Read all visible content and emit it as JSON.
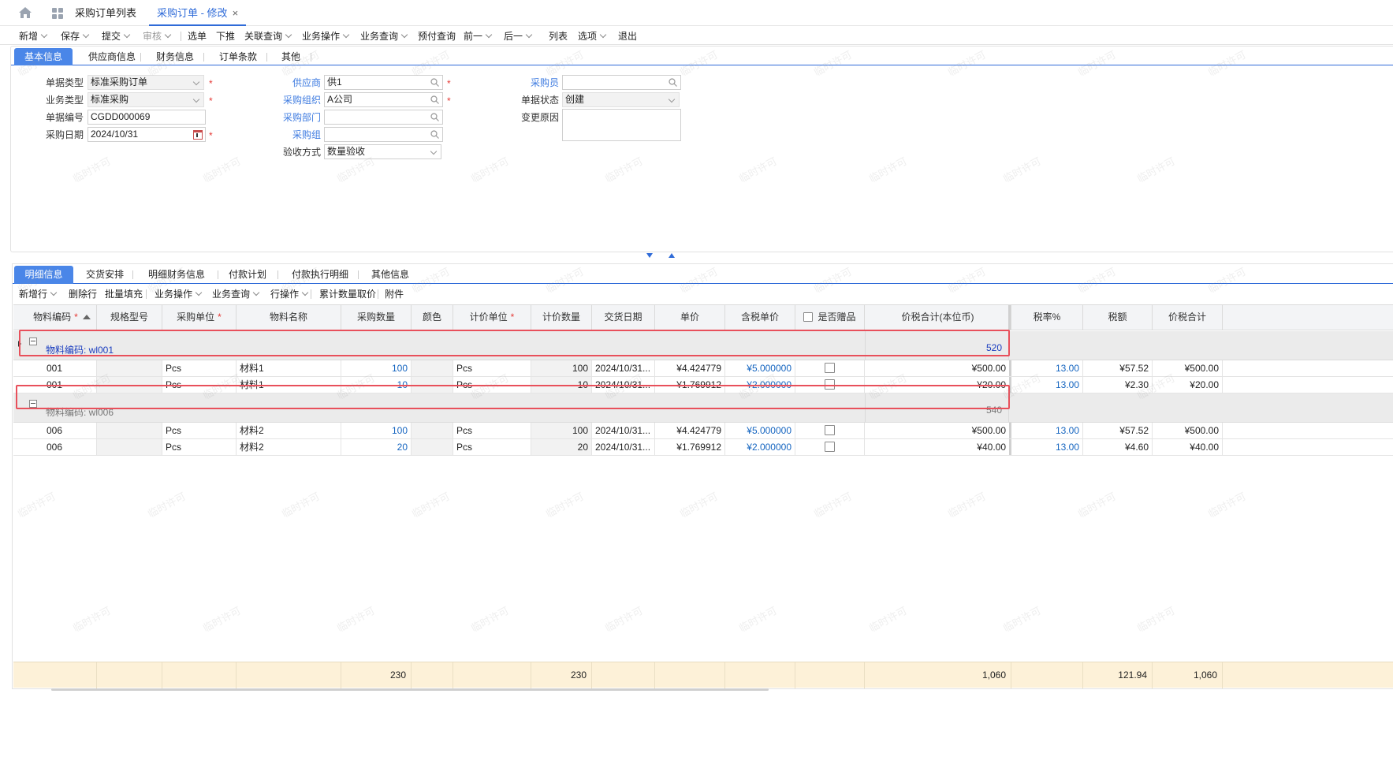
{
  "top_tabs": [
    {
      "label": "采购订单列表"
    },
    {
      "label": "采购订单 - 修改",
      "close": "×"
    }
  ],
  "toolbar": [
    {
      "label": "新增",
      "caret": true
    },
    {
      "label": "保存",
      "caret": true
    },
    {
      "label": "提交",
      "caret": true
    },
    {
      "label": "审核",
      "caret": true,
      "disabled": true
    },
    {
      "label": "选单"
    },
    {
      "label": "下推"
    },
    {
      "label": "关联查询",
      "caret": true
    },
    {
      "label": "业务操作",
      "caret": true
    },
    {
      "label": "业务查询",
      "caret": true
    },
    {
      "label": "预付查询"
    },
    {
      "label": "前一",
      "caret": true
    },
    {
      "label": "后一",
      "caret": true
    },
    {
      "label": "列表"
    },
    {
      "label": "选项",
      "caret": true
    },
    {
      "label": "退出"
    }
  ],
  "header_tabs": [
    "基本信息",
    "供应商信息",
    "财务信息",
    "订单条款",
    "其他"
  ],
  "form": {
    "doc_type": {
      "label": "单据类型",
      "value": "标准采购订单"
    },
    "biz_type": {
      "label": "业务类型",
      "value": "标准采购"
    },
    "doc_no": {
      "label": "单据编号",
      "value": "CGDD000069"
    },
    "purchase_date": {
      "label": "采购日期",
      "value": "2024/10/31"
    },
    "supplier": {
      "label": "供应商",
      "value": "供1"
    },
    "purchase_org": {
      "label": "采购组织",
      "value": "A公司"
    },
    "purchase_dept": {
      "label": "采购部门",
      "value": ""
    },
    "purchase_group": {
      "label": "采购组",
      "value": ""
    },
    "accept_method": {
      "label": "验收方式",
      "value": "数量验收"
    },
    "buyer": {
      "label": "采购员",
      "value": ""
    },
    "doc_status": {
      "label": "单据状态",
      "value": "创建"
    },
    "change_reason": {
      "label": "变更原因",
      "value": ""
    },
    "required_mark": "*"
  },
  "detail_tabs": [
    "明细信息",
    "交货安排",
    "明细财务信息",
    "付款计划",
    "付款执行明细",
    "其他信息"
  ],
  "detail_toolbar": [
    {
      "label": "新增行",
      "caret": true
    },
    {
      "label": "删除行"
    },
    {
      "label": "批量填充"
    },
    {
      "label": "业务操作",
      "caret": true
    },
    {
      "label": "业务查询",
      "caret": true
    },
    {
      "label": "行操作",
      "caret": true
    },
    {
      "label": "累计数量取价"
    },
    {
      "label": "附件"
    }
  ],
  "grid": {
    "columns": [
      "物料编码",
      "规格型号",
      "采购单位",
      "物料名称",
      "采购数量",
      "颜色",
      "计价单位",
      "计价数量",
      "交货日期",
      "单价",
      "含税单价",
      "是否赠品",
      "价税合计(本位币)",
      "税率%",
      "税额",
      "价税合计"
    ],
    "groups": [
      {
        "label": "物料编码: wl001",
        "total": "520",
        "rows": [
          {
            "code": "001",
            "spec": "",
            "unit": "Pcs",
            "name": "材料1",
            "qty": "100",
            "color": "",
            "price_unit": "Pcs",
            "price_qty": "100",
            "date": "2024/10/31...",
            "price": "¥4.424779",
            "tax_price": "¥5.000000",
            "gift": false,
            "total_local": "¥500.00",
            "tax_rate": "13.00",
            "tax": "¥57.52",
            "total": "¥500.00"
          },
          {
            "code": "001",
            "spec": "",
            "unit": "Pcs",
            "name": "材料1",
            "qty": "10",
            "color": "",
            "price_unit": "Pcs",
            "price_qty": "10",
            "date": "2024/10/31...",
            "price": "¥1.769912",
            "tax_price": "¥2.000000",
            "gift": false,
            "total_local": "¥20.00",
            "tax_rate": "13.00",
            "tax": "¥2.30",
            "total": "¥20.00"
          }
        ]
      },
      {
        "label": "物料编码: wl006",
        "total": "540",
        "rows": [
          {
            "code": "006",
            "spec": "",
            "unit": "Pcs",
            "name": "材料2",
            "qty": "100",
            "color": "",
            "price_unit": "Pcs",
            "price_qty": "100",
            "date": "2024/10/31...",
            "price": "¥4.424779",
            "tax_price": "¥5.000000",
            "gift": false,
            "total_local": "¥500.00",
            "tax_rate": "13.00",
            "tax": "¥57.52",
            "total": "¥500.00"
          },
          {
            "code": "006",
            "spec": "",
            "unit": "Pcs",
            "name": "材料2",
            "qty": "20",
            "color": "",
            "price_unit": "Pcs",
            "price_qty": "20",
            "date": "2024/10/31...",
            "price": "¥1.769912",
            "tax_price": "¥2.000000",
            "gift": false,
            "total_local": "¥40.00",
            "tax_rate": "13.00",
            "tax": "¥4.60",
            "total": "¥40.00"
          }
        ]
      }
    ],
    "footer": {
      "qty": "230",
      "price_qty": "230",
      "total_local": "1,060",
      "tax": "121.94",
      "total": "1,060"
    }
  },
  "watermark": "临时许可",
  "colors": {
    "accent": "#2f6bd8",
    "tab_active": "#4a86e8",
    "link": "#3e7be0",
    "highlight": "#e8505b",
    "footer_bg": "#fdf1d8"
  }
}
